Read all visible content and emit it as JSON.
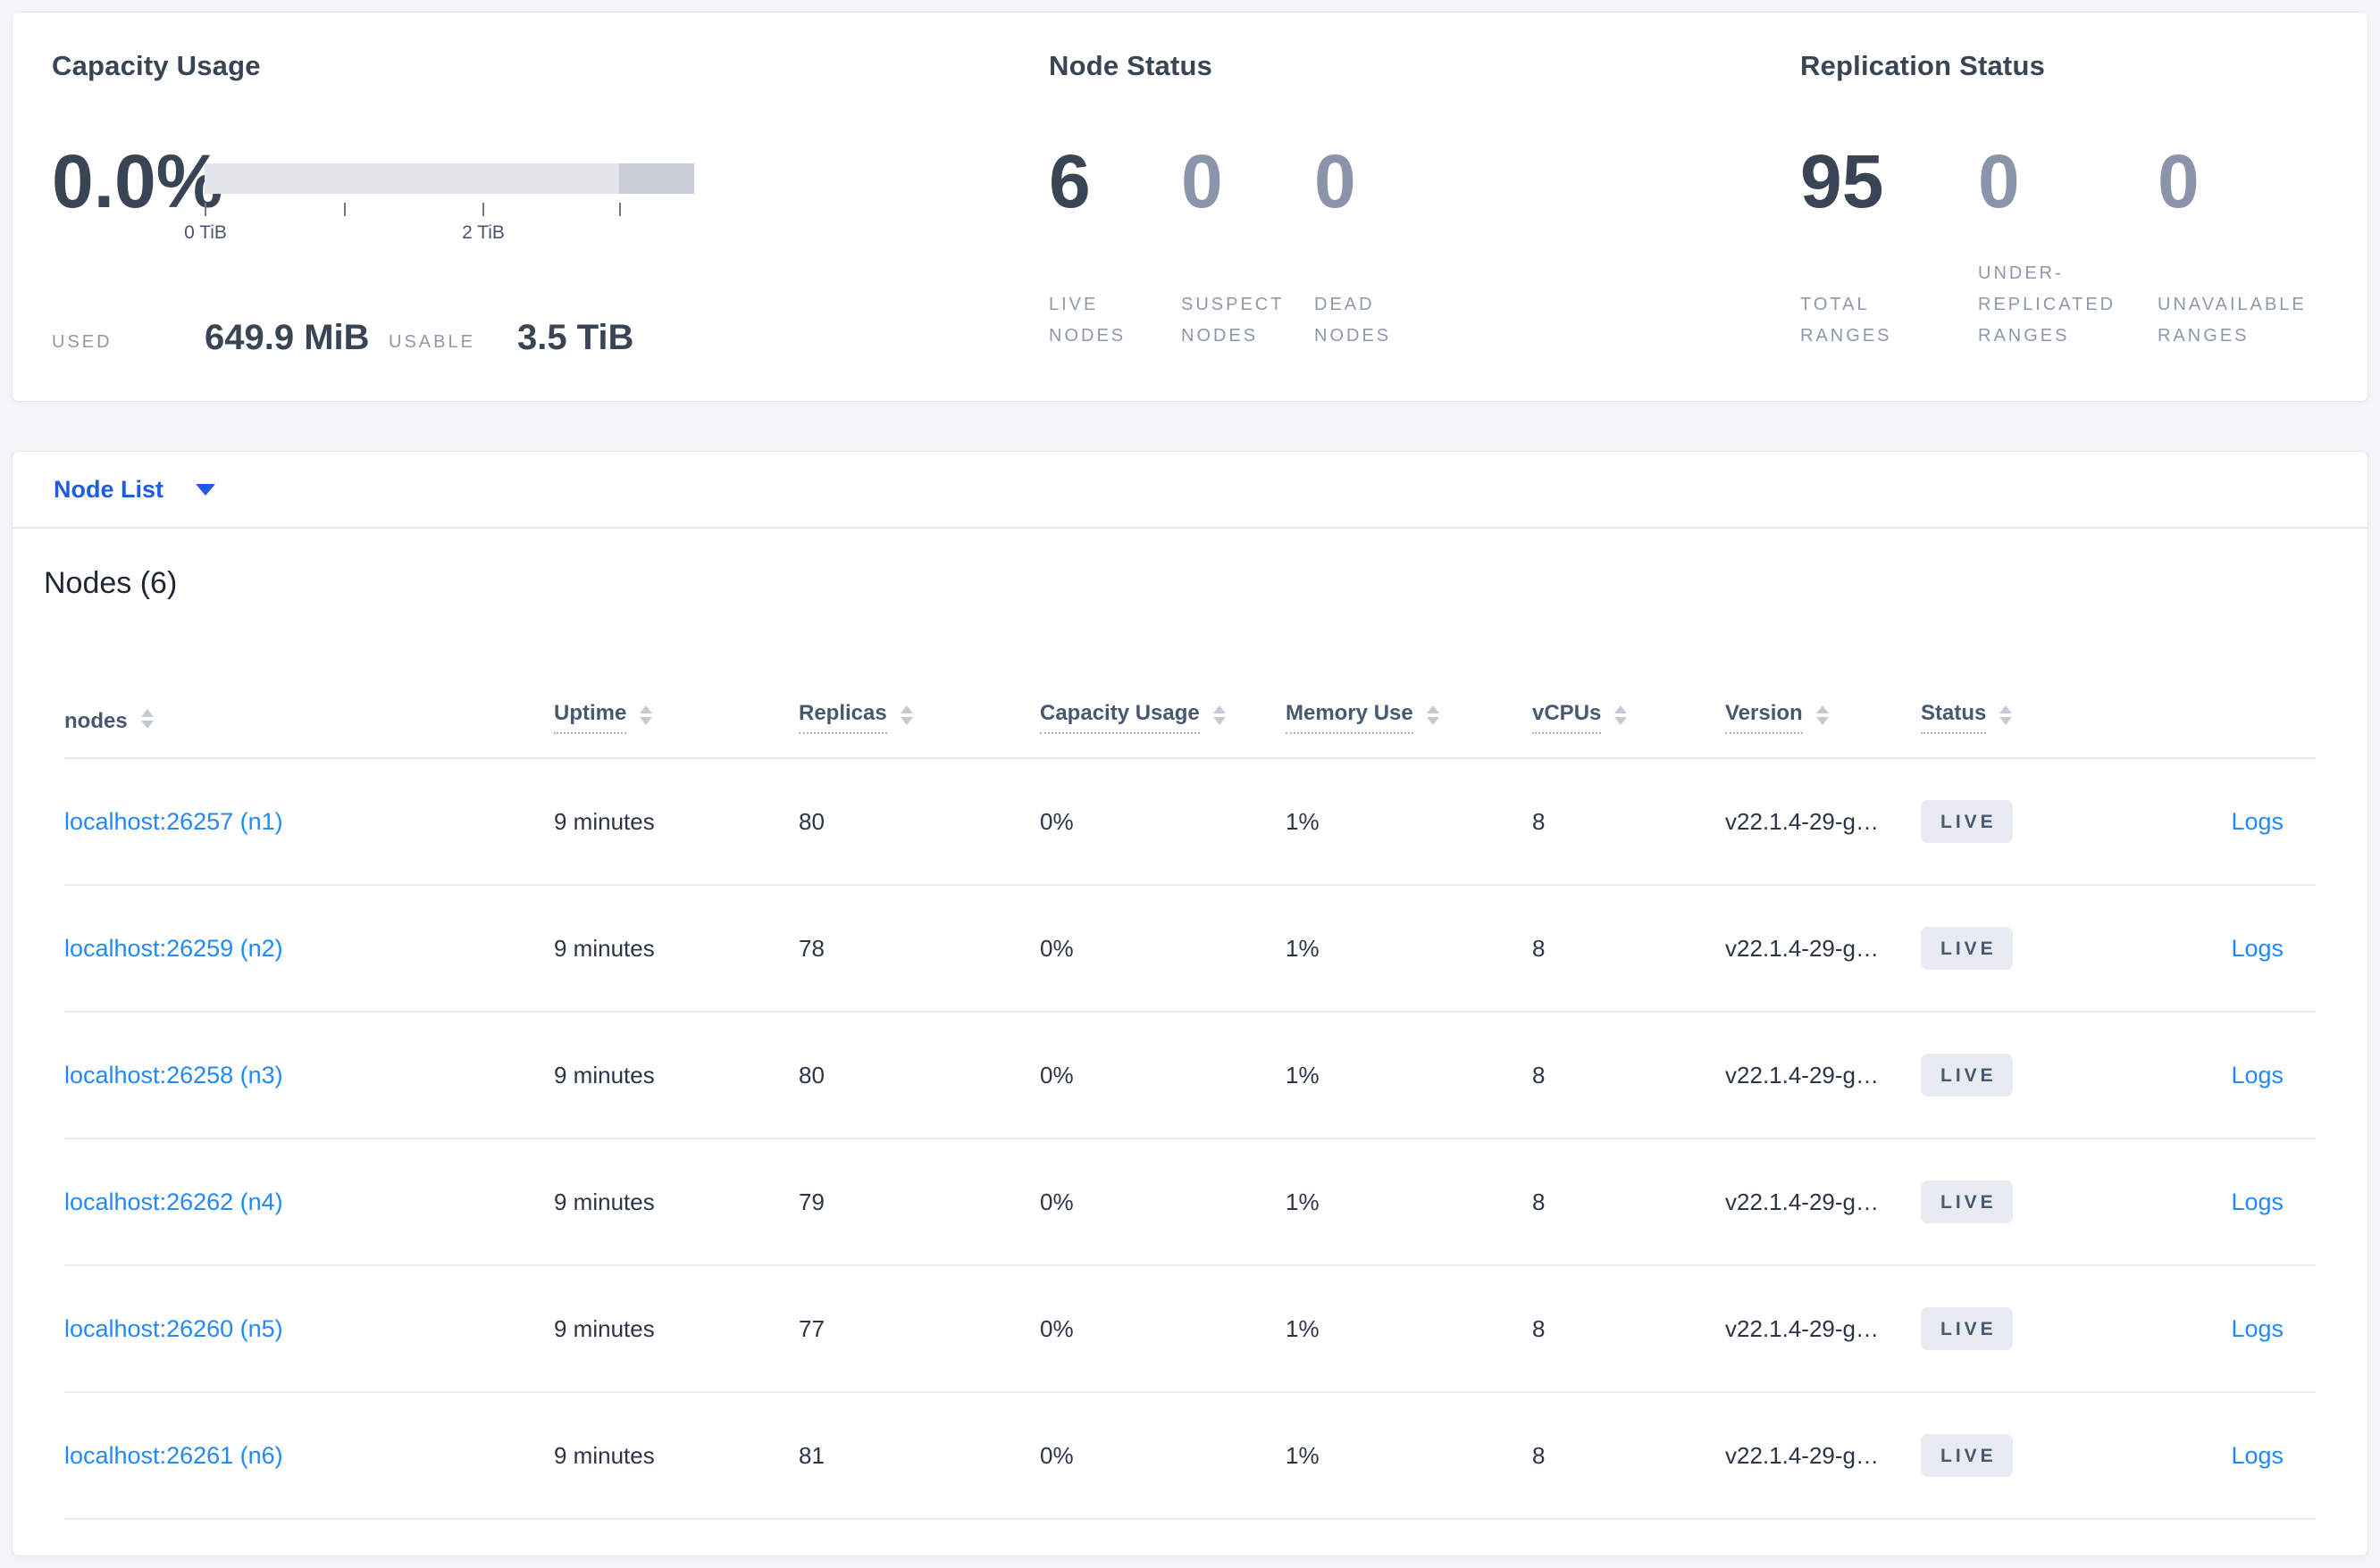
{
  "colors": {
    "link_blue": "#2289f7",
    "selector_blue": "#1d5ce6",
    "badge_bg": "#e8ebf1",
    "badge_text": "#475872",
    "heading_dark": "#394455",
    "muted_number": "#8a94aa",
    "label_gray": "#8e98ab",
    "bar_light": "#e3e5eb",
    "bar_dark": "#c9cdd7"
  },
  "summary": {
    "capacity": {
      "title": "Capacity Usage",
      "percent_used": "0.0%",
      "tick_labels": [
        "0 TiB",
        "2 TiB"
      ],
      "used_label": "USED",
      "used_value": "649.9 MiB",
      "usable_label": "USABLE",
      "usable_value": "3.5 TiB"
    },
    "node_status": {
      "title": "Node Status",
      "stats": [
        {
          "value": "6",
          "lines": [
            "LIVE",
            "NODES"
          ]
        },
        {
          "value": "0",
          "lines": [
            "SUSPECT",
            "NODES"
          ]
        },
        {
          "value": "0",
          "lines": [
            "DEAD",
            "NODES"
          ]
        }
      ]
    },
    "replication": {
      "title": "Replication Status",
      "stats": [
        {
          "value": "95",
          "lines": [
            "TOTAL",
            "RANGES"
          ]
        },
        {
          "value": "0",
          "lines": [
            "UNDER-",
            "REPLICATED",
            "RANGES"
          ]
        },
        {
          "value": "0",
          "lines": [
            "UNAVAILABLE",
            "RANGES"
          ]
        }
      ]
    }
  },
  "view_selector": {
    "label": "Node List"
  },
  "nodes_section": {
    "title": "Nodes (6)",
    "logs_label": "Logs",
    "columns": [
      {
        "label": "nodes"
      },
      {
        "label": "Uptime"
      },
      {
        "label": "Replicas"
      },
      {
        "label": "Capacity Usage"
      },
      {
        "label": "Memory Use"
      },
      {
        "label": "vCPUs"
      },
      {
        "label": "Version"
      },
      {
        "label": "Status"
      }
    ],
    "rows": [
      {
        "address": "localhost:26257 (n1)",
        "uptime": "9 minutes",
        "replicas": "80",
        "capacity": "0%",
        "memory": "1%",
        "vcpus": "8",
        "version": "v22.1.4-29-g…",
        "status": "LIVE"
      },
      {
        "address": "localhost:26259 (n2)",
        "uptime": "9 minutes",
        "replicas": "78",
        "capacity": "0%",
        "memory": "1%",
        "vcpus": "8",
        "version": "v22.1.4-29-g…",
        "status": "LIVE"
      },
      {
        "address": "localhost:26258 (n3)",
        "uptime": "9 minutes",
        "replicas": "80",
        "capacity": "0%",
        "memory": "1%",
        "vcpus": "8",
        "version": "v22.1.4-29-g…",
        "status": "LIVE"
      },
      {
        "address": "localhost:26262 (n4)",
        "uptime": "9 minutes",
        "replicas": "79",
        "capacity": "0%",
        "memory": "1%",
        "vcpus": "8",
        "version": "v22.1.4-29-g…",
        "status": "LIVE"
      },
      {
        "address": "localhost:26260 (n5)",
        "uptime": "9 minutes",
        "replicas": "77",
        "capacity": "0%",
        "memory": "1%",
        "vcpus": "8",
        "version": "v22.1.4-29-g…",
        "status": "LIVE"
      },
      {
        "address": "localhost:26261 (n6)",
        "uptime": "9 minutes",
        "replicas": "81",
        "capacity": "0%",
        "memory": "1%",
        "vcpus": "8",
        "version": "v22.1.4-29-g…",
        "status": "LIVE"
      }
    ]
  }
}
